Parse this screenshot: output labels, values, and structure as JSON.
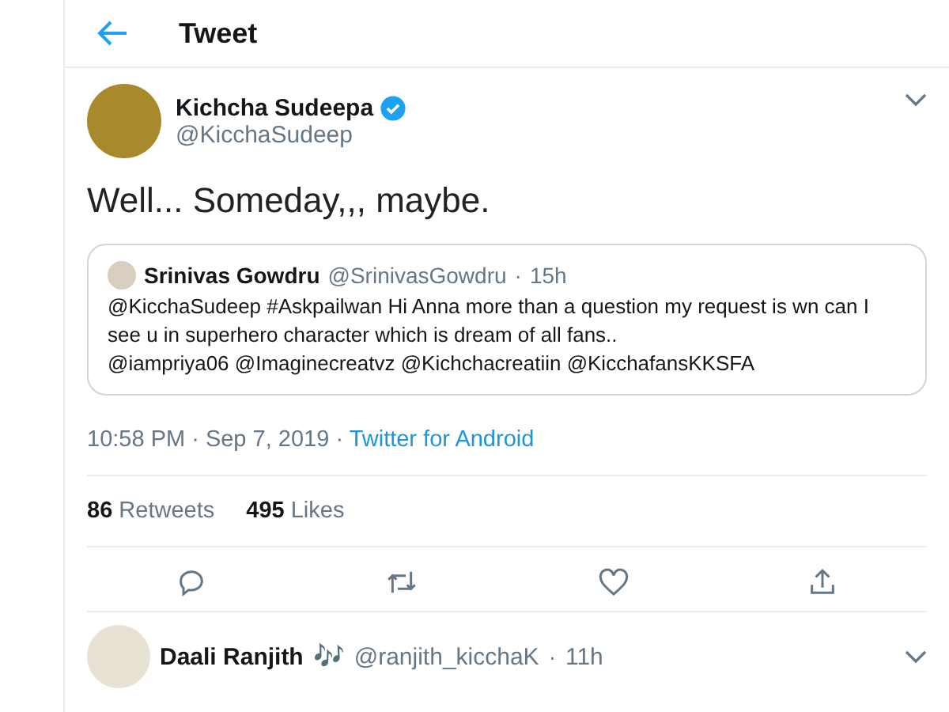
{
  "header": {
    "title": "Tweet"
  },
  "tweet": {
    "author": {
      "name": "Kichcha Sudeepa",
      "handle": "@KicchaSudeep",
      "verified": true
    },
    "text": "Well... Someday,,, maybe.",
    "quote": {
      "name": "Srinivas Gowdru",
      "handle": "@SrinivasGowdru",
      "separator": "·",
      "time": "15h",
      "text": "@KicchaSudeep #Askpailwan Hi Anna more than a question my request is wn can I see u in superhero character which is dream of all fans..",
      "mentions": "@iampriya06 @Imaginecreatvz @Kichchacreatiin @KicchafansKKSFA"
    },
    "timestamp": "10:58 PM · Sep 7, 2019",
    "separator": "·",
    "source": "Twitter for Android",
    "stats": [
      {
        "count": "86",
        "label": "Retweets"
      },
      {
        "count": "495",
        "label": "Likes"
      }
    ],
    "actions": [
      {
        "kind": "reply"
      },
      {
        "kind": "retweet"
      },
      {
        "kind": "like"
      },
      {
        "kind": "share"
      }
    ]
  },
  "reply": {
    "name": "Daali Ranjith",
    "emoji": "🎶",
    "handle": "@ranjith_kicchaK",
    "separator": "·",
    "time": "11h"
  }
}
